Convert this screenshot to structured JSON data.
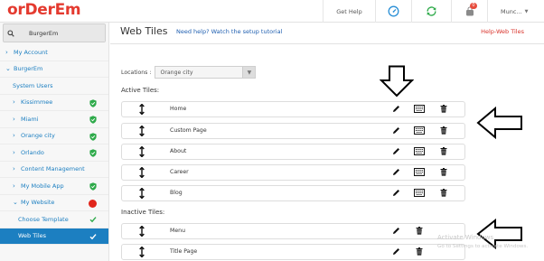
{
  "app": {
    "logo": "orDerEm"
  },
  "topbar": {
    "get_help": "Get Help",
    "notification_count": "0",
    "user_name": "Munc..."
  },
  "sidebar": {
    "search_value": "BurgerEm",
    "items": [
      {
        "label": "My Account",
        "chevron": true
      },
      {
        "label": "BurgerEm",
        "chevron": true
      },
      {
        "label": "System Users",
        "chevron": false
      },
      {
        "label": "Kissimmee",
        "chevron": true,
        "status": "shield"
      },
      {
        "label": "Miami",
        "chevron": true,
        "status": "shield"
      },
      {
        "label": "Orange city",
        "chevron": true,
        "status": "shield"
      },
      {
        "label": "Orlando",
        "chevron": true,
        "status": "shield"
      },
      {
        "label": "Content Management",
        "chevron": true
      },
      {
        "label": "My Mobile App",
        "chevron": true,
        "status": "shield"
      },
      {
        "label": "My Website",
        "chevron": true,
        "status": "red-dot"
      },
      {
        "label": "Choose Template",
        "chevron": false,
        "status": "check"
      },
      {
        "label": "Web Tiles",
        "chevron": false,
        "status": "check",
        "active": true
      }
    ]
  },
  "main": {
    "title": "Web Tiles",
    "help_link": "Need help? Watch the setup tutorial",
    "help_right": "Help-Web Tiles",
    "locations_label": "Locations :",
    "location_value": "Orange city",
    "active_title": "Active Tiles:",
    "inactive_title": "Inactive Tiles:",
    "active_tiles": [
      {
        "name": "Home",
        "actions": [
          "edit",
          "keyboard",
          "delete"
        ]
      },
      {
        "name": "Custom Page",
        "actions": [
          "edit",
          "keyboard",
          "delete"
        ]
      },
      {
        "name": "About",
        "actions": [
          "edit",
          "keyboard",
          "delete"
        ]
      },
      {
        "name": "Career",
        "actions": [
          "edit",
          "keyboard",
          "delete"
        ]
      },
      {
        "name": "Blog",
        "actions": [
          "edit",
          "keyboard",
          "delete"
        ]
      }
    ],
    "inactive_tiles": [
      {
        "name": "Menu",
        "actions": [
          "edit",
          "delete"
        ]
      },
      {
        "name": "Title Page",
        "actions": [
          "edit",
          "delete"
        ]
      }
    ]
  },
  "watermark": {
    "line1": "Activate Windows",
    "line2": "Go to Settings to activate Windows."
  },
  "colors": {
    "brand_red": "#e43a2f",
    "link_blue": "#1c7fc1",
    "active_bg": "#1c7fc1",
    "shield_green": "#2eaa4a"
  }
}
